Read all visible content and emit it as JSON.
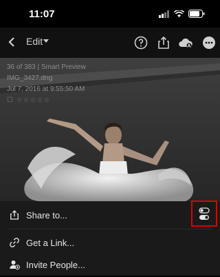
{
  "status": {
    "time": "11:07"
  },
  "nav": {
    "edit_label": "Edit"
  },
  "photo_info": {
    "count": "36 of 383 | Smart Preview",
    "filename": "IMG_3427.dng",
    "datetime": "Jul 7, 2016 at 9:55:50 AM",
    "rating": "☐ ☆☆☆☆☆"
  },
  "sheet": {
    "items": [
      {
        "label": "Share to...",
        "icon": "share-icon"
      },
      {
        "label": "Get a Link...",
        "icon": "link-icon"
      },
      {
        "label": "Invite People...",
        "icon": "invite-people-icon"
      }
    ]
  },
  "colors": {
    "highlight": "#e00000",
    "sheet_bg": "#1a1a1a"
  }
}
